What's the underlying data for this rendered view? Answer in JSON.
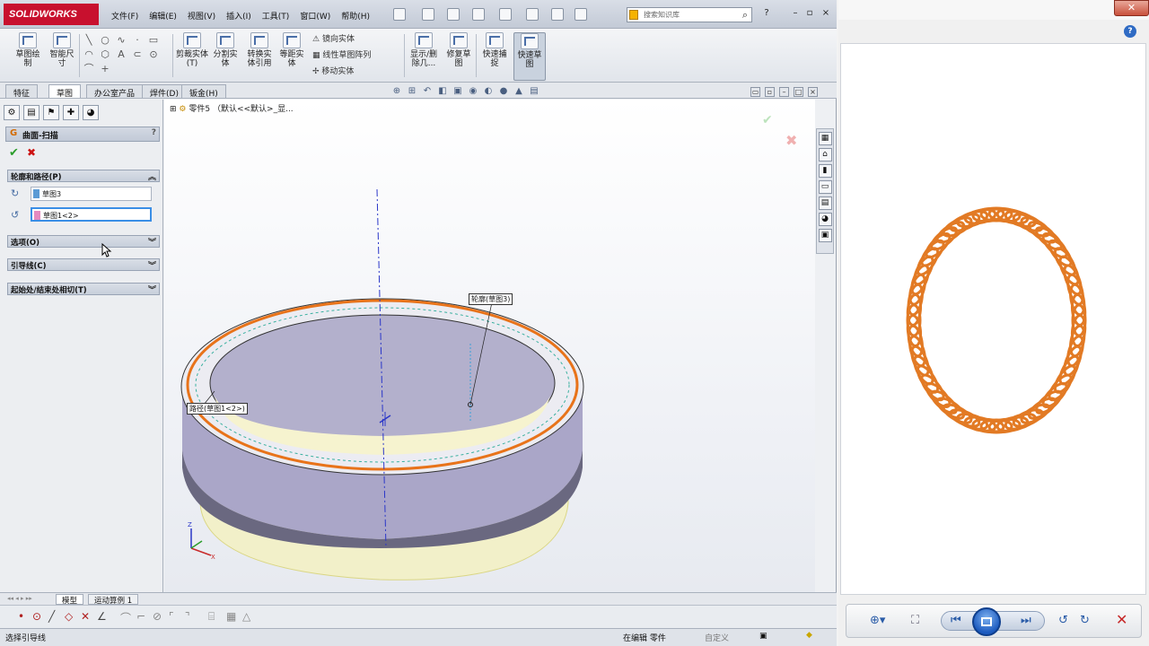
{
  "app": {
    "brand": "SOLIDWORKS",
    "menus": [
      "文件(F)",
      "编辑(E)",
      "视图(V)",
      "插入(I)",
      "工具(T)",
      "窗口(W)",
      "帮助(H)"
    ],
    "search_placeholder": "搜索知识库"
  },
  "commands": {
    "sketch": "草图绘制",
    "smart_dim": "智能尺寸",
    "trim": "剪裁实体(T)",
    "convert": "转换实体引用",
    "offset": "等距实体",
    "split": "分割实体",
    "mirror": "镜向实体",
    "linear_pattern": "线性草图阵列",
    "move": "移动实体",
    "show_hide": "显示/删除几...",
    "repair": "修复草图",
    "quick_snap": "快速捕捉",
    "rapid_sketch": "快速草图"
  },
  "tabs": [
    "特征",
    "草图",
    "办公室产品",
    "焊件(D)",
    "钣金(H)"
  ],
  "tree_root": "零件5 （默认<<默认>_显...",
  "property_manager": {
    "title": "曲面-扫描",
    "group_profile": "轮廓和路径(P)",
    "profile_value": "草图3",
    "path_value": "草图1<2>",
    "group_options": "选项(O)",
    "group_guide": "引导线(C)",
    "group_tangency": "起始处/结束处相切(T)"
  },
  "callouts": {
    "profile": "轮廓(草图3)",
    "path": "路径(草图1<2>)"
  },
  "model_tabs": [
    "模型",
    "运动算例 1"
  ],
  "status": {
    "hint": "选择引导线",
    "mode": "在编辑 零件",
    "custom": "自定义"
  },
  "colors": {
    "accent": "#c8102e",
    "path_orange": "#e8731a",
    "spring": "#e27a24",
    "player_blue": "#1d5bbf"
  }
}
